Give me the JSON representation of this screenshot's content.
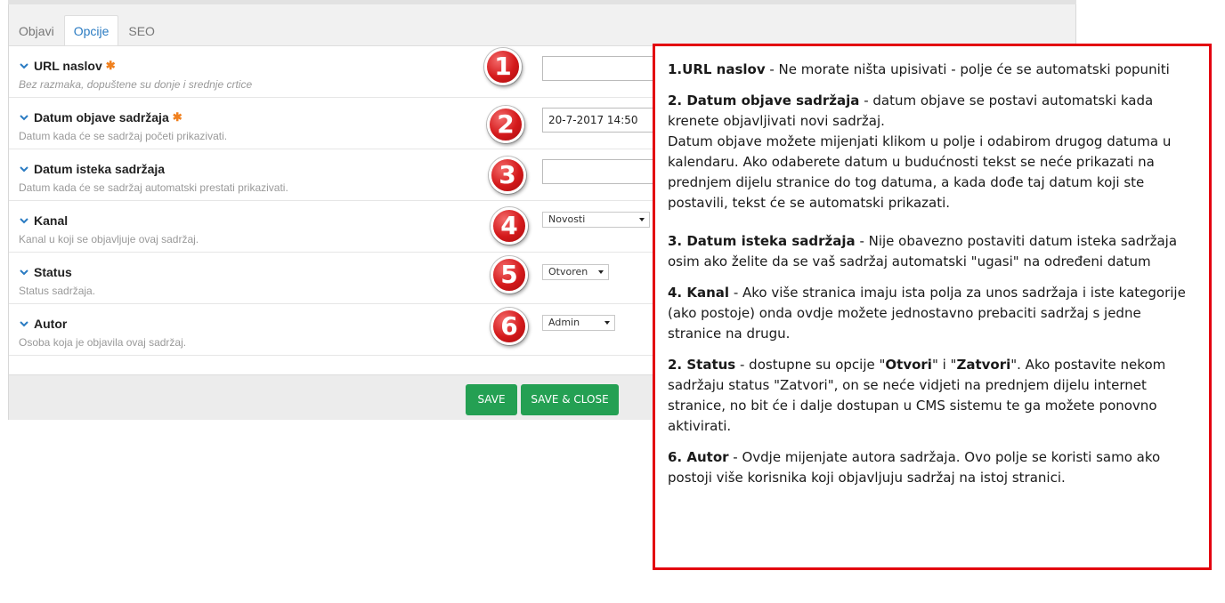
{
  "tabs": [
    "Objavi",
    "Opcije",
    "SEO"
  ],
  "fields": [
    {
      "label": "URL naslov",
      "required": true,
      "description": "Bez razmaka, dopuštene su donje i srednje crtice",
      "number": "1",
      "value": ""
    },
    {
      "label": "Datum objave sadržaja",
      "required": true,
      "description": "Datum kada će se sadržaj početi prikazivati.",
      "number": "2",
      "value": "20-7-2017 14:50"
    },
    {
      "label": "Datum isteka sadržaja",
      "required": false,
      "description": "Datum kada će se sadržaj automatski prestati prikazivati.",
      "number": "3",
      "value": ""
    },
    {
      "label": "Kanal",
      "required": false,
      "description": "Kanal u koji se objavljuje ovaj sadržaj.",
      "number": "4",
      "value": "Novosti"
    },
    {
      "label": "Status",
      "required": false,
      "description": "Status sadržaja.",
      "number": "5",
      "value": "Otvoren"
    },
    {
      "label": "Autor",
      "required": false,
      "description": "Osoba koja je objavila ovaj sadržaj.",
      "number": "6",
      "value": "Admin"
    }
  ],
  "required_mark": "✱",
  "buttons": {
    "save": "SAVE",
    "save_close": "SAVE & CLOSE"
  },
  "callout": {
    "p1_bold": "1.URL naslov",
    "p1_text": " -  Ne morate ništa upisivati - polje će se automatski popuniti",
    "p2_bold": "2. Datum objave sadržaja",
    "p2_text": " - datum objave se postavi automatski kada krenete objavljivati novi sadržaj.",
    "p2_text2": "Datum objave možete mijenjati klikom u polje i odabirom drugog datuma u kalendaru. Ako odaberete datum u budućnosti tekst se neće prikazati na prednjem dijelu stranice do tog datuma, a kada dođe taj datum koji ste postavili, tekst će se automatski prikazati.",
    "p3_bold": "3. Datum isteka sadržaja",
    "p3_text": " - Nije obavezno postaviti datum isteka sadržaja osim ako želite da se vaš sadržaj automatski \"ugasi\" na određeni datum",
    "p4_bold": "4. Kanal",
    "p4_text": " - Ako više stranica imaju ista polja za unos sadržaja i iste kategorije (ako postoje) onda ovdje možete jednostavno prebaciti sadržaj s jedne stranice na drugu.",
    "p5_bold": "2. Status",
    "p5_text_a": " - dostupne su opcije \"",
    "p5_bold_a": "Otvori",
    "p5_text_b": "\" i \"",
    "p5_bold_b": "Zatvori",
    "p5_text_c": "\". Ako postavite nekom sadržaju status \"Zatvori\", on se neće vidjeti na prednjem dijelu internet stranice, no bit će i dalje dostupan u CMS sistemu te ga možete ponovno aktivirati.",
    "p6_bold": "6. Autor",
    "p6_text": " - Ovdje mijenjate autora sadržaja. Ovo polje se koristi samo ako postoji više korisnika koji objavljuju sadržaj na istoj stranici."
  }
}
